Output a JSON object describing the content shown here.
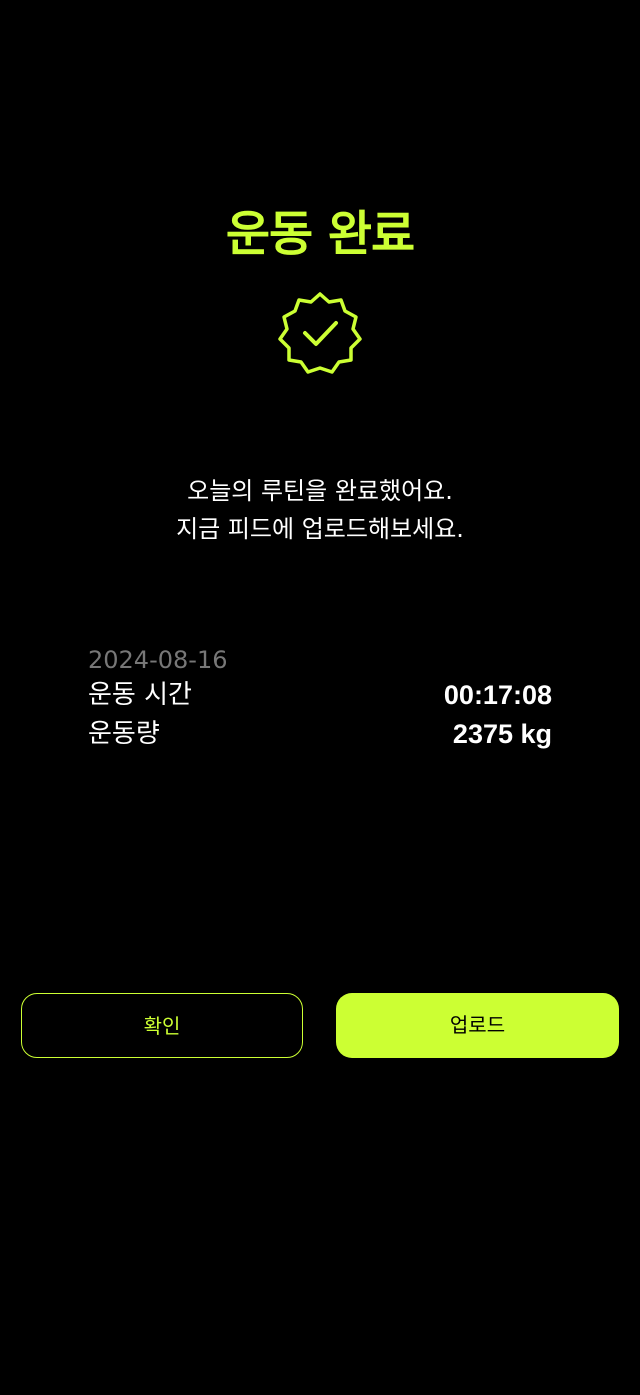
{
  "header": {
    "title": "운동 완료"
  },
  "badge": {
    "icon": "check-badge-icon",
    "color": "#ccff33"
  },
  "message": {
    "line1": "오늘의 루틴을 완료했어요.",
    "line2": "지금 피드에 업로드해보세요."
  },
  "summary": {
    "date": "2024-08-16",
    "stats": [
      {
        "label": "운동 시간",
        "value": "00:17:08"
      },
      {
        "label": "운동량",
        "value": "2375 kg"
      }
    ]
  },
  "actions": {
    "confirm_label": "확인",
    "upload_label": "업로드"
  },
  "colors": {
    "accent": "#ccff33",
    "background": "#000000",
    "muted_text": "#777777"
  }
}
